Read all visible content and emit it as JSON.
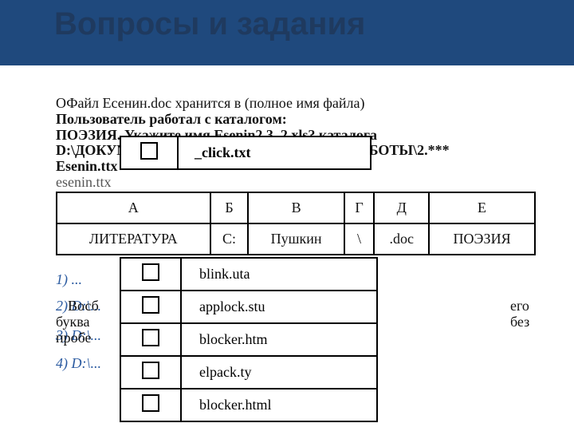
{
  "title": "Вопросы и задания",
  "overlay": {
    "l1": "ОФайл Есенин.doc хранится в (полное имя файла)",
    "l2": "Пользователь работал с каталогом:",
    "l3": "ПОЭЗИЯ. Укажите имя Esenin2.3. 2.xls? каталога",
    "l4": "D:\\ДОКУМЕНТЫ\\ФОТО\\ПРАКТИЧЕСКИЕ РАБОТЫ\\2.***",
    "l5": "Esenin.ttx",
    "l6": "esenin.ttx"
  },
  "cbox1": {
    "a": "□",
    "b": "_click.txt"
  },
  "mainTable": {
    "head": [
      "А",
      "Б",
      "В",
      "Г",
      "Д",
      "Е"
    ],
    "row": [
      "ЛИТЕРАТУРА",
      "C:",
      "Пушкин",
      "\\",
      ".doc",
      "ПОЭЗИЯ"
    ]
  },
  "leftList": {
    "i1": "1) ...",
    "i2": "2) D:\\...",
    "i3": "3) D:\\...",
    "i4": "4) D:\\..."
  },
  "midText": {
    "t1": "Восб",
    "t2": "буква",
    "t3": "пробе"
  },
  "rightText": {
    "t1": "его",
    "t2": "без"
  },
  "cbox2": {
    "a": "blink.uta",
    "b": "applock.stu",
    "c": "blocker.htm",
    "d": "elpack.ty",
    "e": "blocker.html"
  }
}
